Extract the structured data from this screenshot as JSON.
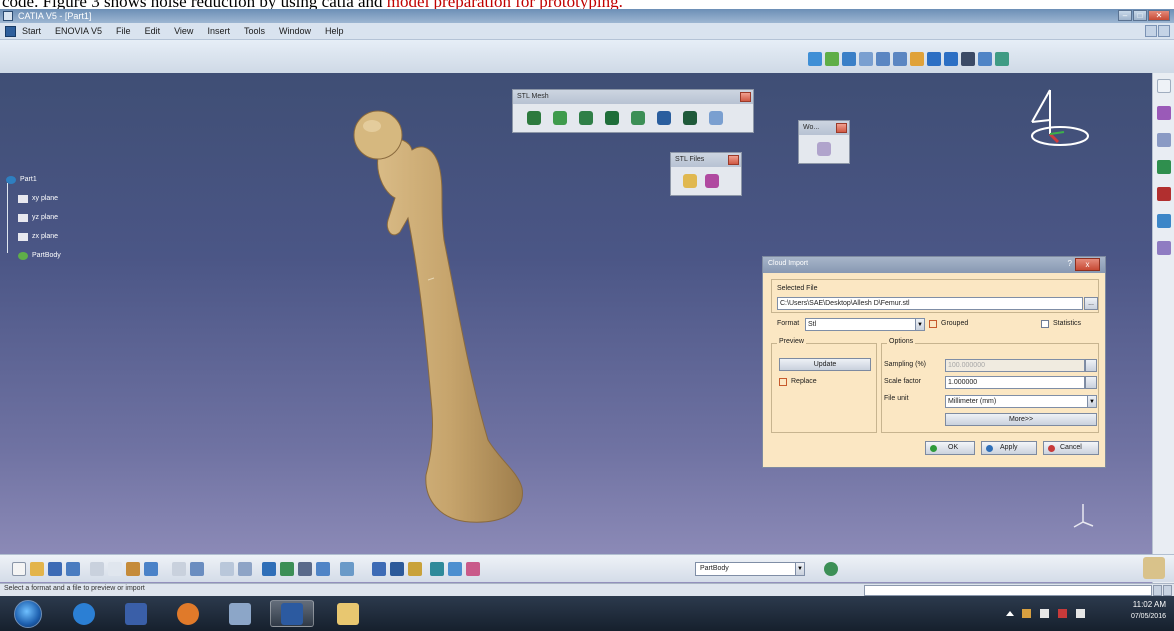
{
  "caption": {
    "text_a": "code. Figure 3 shows noise reduction by using catia and ",
    "text_b": "model preparation for prototyping."
  },
  "window": {
    "title": "CATIA V5 - [Part1]"
  },
  "menubar": {
    "items": [
      "Start",
      "ENOVIA V5",
      "File",
      "Edit",
      "View",
      "Insert",
      "Tools",
      "Window",
      "Help"
    ]
  },
  "tree": {
    "root": "Part1",
    "items": [
      "xy plane",
      "yz plane",
      "zx plane",
      "PartBody"
    ]
  },
  "toolbars": {
    "stl_mesh": "STL Mesh",
    "stl_files": "STL Files",
    "wo": "Wo..."
  },
  "cloud_import": {
    "title": "Cloud Import",
    "help": "?",
    "close": "x",
    "selected_file_label": "Selected File",
    "file_path": "C:\\Users\\SAE\\Desktop\\Allesh D\\Femur.stl",
    "browse": "...",
    "format_label": "Format",
    "format_value": "Stl",
    "grouped_label": "Grouped",
    "grouped_checked": true,
    "statistics_label": "Statistics",
    "statistics_checked": false,
    "preview_label": "Preview",
    "update_button": "Update",
    "replace_label": "Replace",
    "replace_checked": true,
    "options_label": "Options",
    "sampling_label": "Sampling (%)",
    "sampling_value": "100.000000",
    "scale_factor_label": "Scale factor",
    "scale_factor_value": "1.000000",
    "file_unit_label": "File unit",
    "file_unit_value": "Millimeter (mm)",
    "more_button": "More>>",
    "ok_button": "OK",
    "apply_button": "Apply",
    "cancel_button": "Cancel"
  },
  "bottom_toolbar": {
    "part_selector_value": "PartBody"
  },
  "status": {
    "message": "Select a format and a file to preview or import"
  },
  "clock": {
    "time": "11:02 AM",
    "date": "07/05/2016"
  },
  "colors": {
    "viewport_top": "#3d4d72",
    "viewport_bottom": "#9390bc",
    "bone": "#c9a872",
    "dialog_bg": "#fbe7c3",
    "caption_red": "#c00000"
  }
}
